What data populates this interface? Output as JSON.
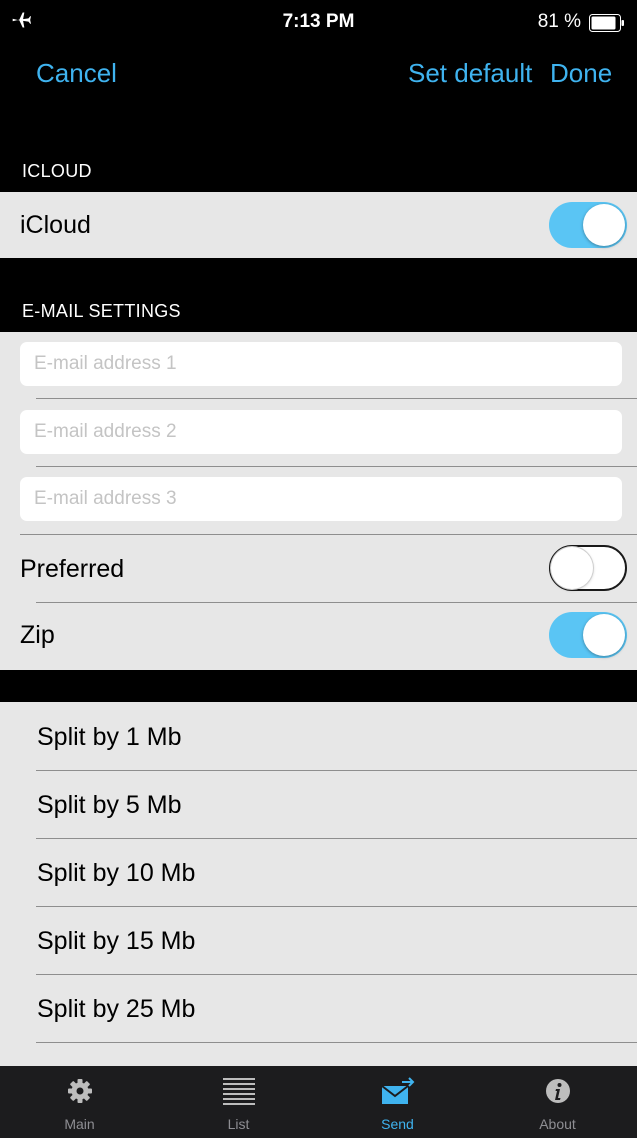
{
  "status_bar": {
    "time": "7:13 PM",
    "battery_percent": "81 %"
  },
  "nav": {
    "cancel_label": "Cancel",
    "set_default_label": "Set default",
    "done_label": "Done"
  },
  "icloud_section": {
    "header": "ICLOUD",
    "rows": [
      {
        "label": "iCloud",
        "on": true
      }
    ]
  },
  "email_section": {
    "header": "E-MAIL SETTINGS",
    "inputs": [
      {
        "value": "",
        "placeholder": "E-mail address 1"
      },
      {
        "value": "",
        "placeholder": "E-mail address 2"
      },
      {
        "value": "",
        "placeholder": "E-mail address 3"
      }
    ],
    "toggles": [
      {
        "label": "Preferred",
        "on": false
      },
      {
        "label": "Zip",
        "on": true
      }
    ]
  },
  "split_options": [
    "Split by 1 Mb",
    "Split by 5 Mb",
    "Split by 10 Mb",
    "Split by 15 Mb",
    "Split by 25 Mb"
  ],
  "tabs": [
    {
      "label": "Main",
      "icon": "gear-icon",
      "active": false
    },
    {
      "label": "List",
      "icon": "list-icon",
      "active": false
    },
    {
      "label": "Send",
      "icon": "send-mail-icon",
      "active": true
    },
    {
      "label": "About",
      "icon": "info-icon",
      "active": false
    }
  ],
  "colors": {
    "accent": "#3fb3ef",
    "toggle_on": "#5ac5f4",
    "group_background": "#e7e7e7",
    "tab_bar_background": "#1c1c1e"
  }
}
